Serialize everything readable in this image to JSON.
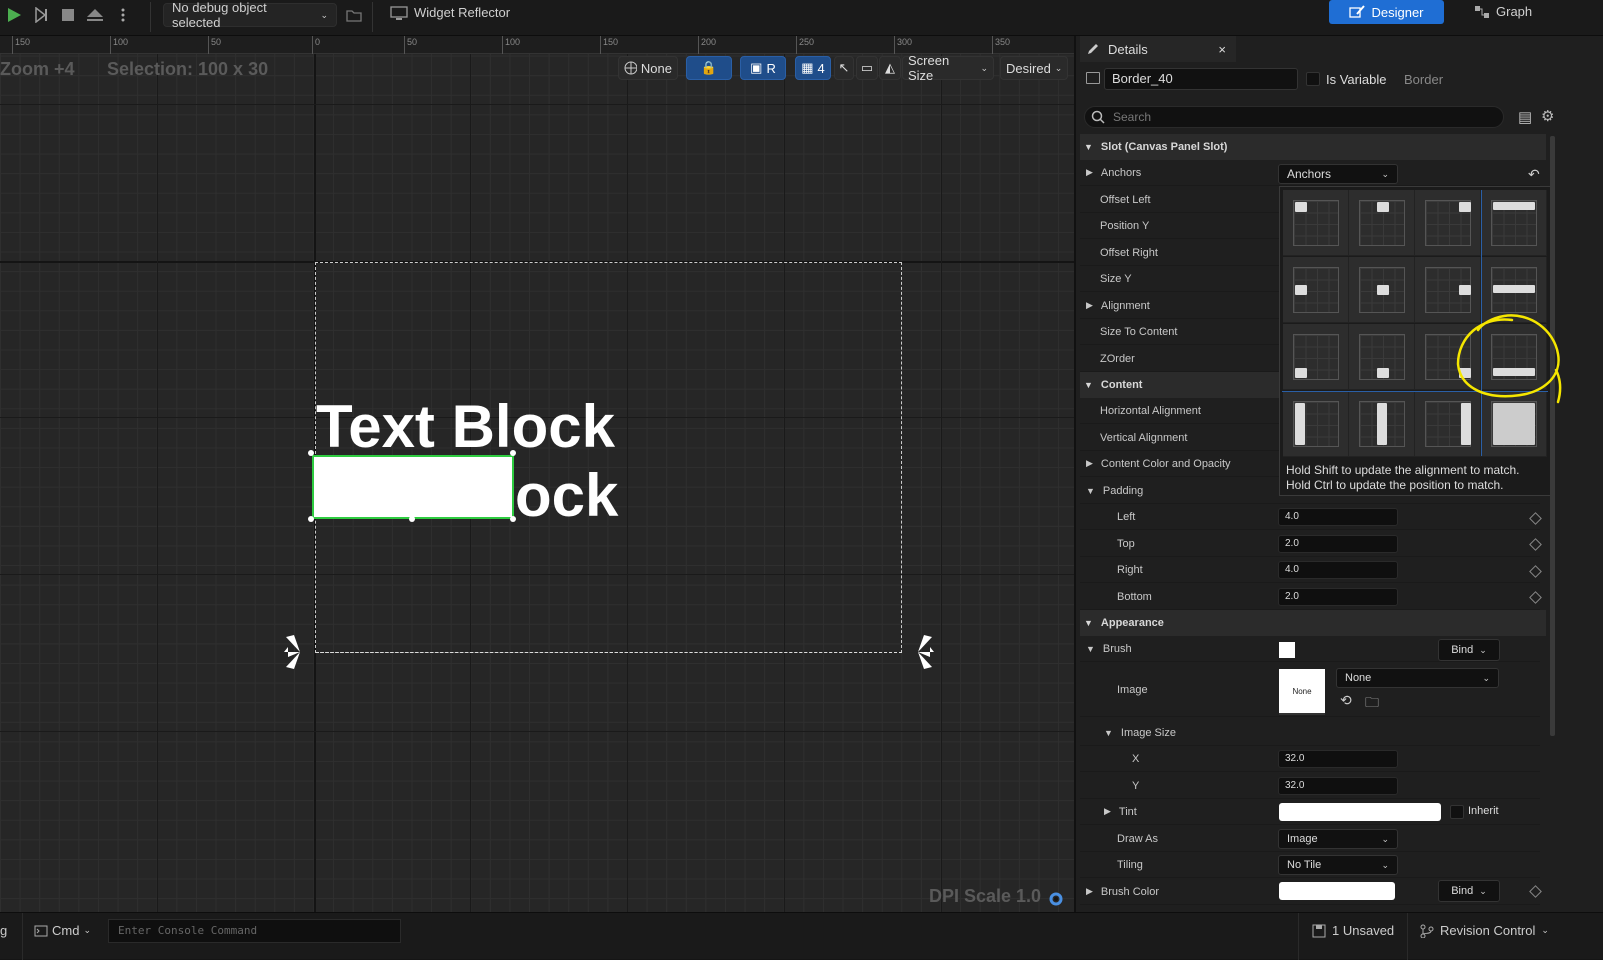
{
  "toolbar": {
    "debug_object": "No debug object selected",
    "widget_reflector": "Widget Reflector",
    "designer": "Designer",
    "graph": "Graph"
  },
  "viewport": {
    "ruler_labels": [
      "150",
      "100",
      "50",
      "0",
      "50",
      "100",
      "150",
      "200",
      "250",
      "300",
      "350"
    ],
    "zoom": "Zoom +4",
    "selection": "Selection: 100 x 30",
    "none_label": "None",
    "r_label": "R",
    "grid_num": "4",
    "screen_size": "Screen Size",
    "desired": "Desired",
    "text_line1": "Text Block",
    "text_line2": "ock",
    "dpi": "DPI Scale 1.0"
  },
  "details": {
    "tab_title": "Details",
    "close": "×",
    "widget_name": "Border_40",
    "is_variable": "Is Variable",
    "widget_type": "Border",
    "search_placeholder": "Search",
    "slot_category": "Slot (Canvas Panel Slot)",
    "anchors": "Anchors",
    "anchors_value": "Anchors",
    "offset_left": "Offset Left",
    "position_y": "Position Y",
    "offset_right": "Offset Right",
    "size_y": "Size Y",
    "alignment": "Alignment",
    "size_to_content": "Size To Content",
    "zorder": "ZOrder",
    "content_category": "Content",
    "horizontal_alignment": "Horizontal Alignment",
    "vertical_alignment": "Vertical Alignment",
    "content_color": "Content Color and Opacity",
    "padding": "Padding",
    "left": "Left",
    "left_value": "4.0",
    "top": "Top",
    "top_value": "2.0",
    "right": "Right",
    "right_value": "4.0",
    "bottom": "Bottom",
    "bottom_value": "2.0",
    "anchor_hint_1": "Hold Shift to update the alignment to match.",
    "anchor_hint_2": "Hold Ctrl to update the position to match.",
    "appearance_category": "Appearance",
    "brush": "Brush",
    "bind": "Bind",
    "image": "Image",
    "image_none": "None",
    "image_thumb": "None",
    "image_size": "Image Size",
    "x": "X",
    "x_value": "32.0",
    "y": "Y",
    "y_value": "32.0",
    "tint": "Tint",
    "inherit": "Inherit",
    "draw_as": "Draw As",
    "draw_as_value": "Image",
    "tiling": "Tiling",
    "tiling_value": "No Tile",
    "brush_color": "Brush Color",
    "bind2": "Bind"
  },
  "status": {
    "log": "g",
    "cmd": "Cmd",
    "console_placeholder": "Enter Console Command",
    "unsaved": "1 Unsaved",
    "revision_control": "Revision Control"
  },
  "colors": {
    "accent": "#1f6ed4",
    "selection_green": "#2ecc40",
    "annotation": "#f5e600"
  }
}
